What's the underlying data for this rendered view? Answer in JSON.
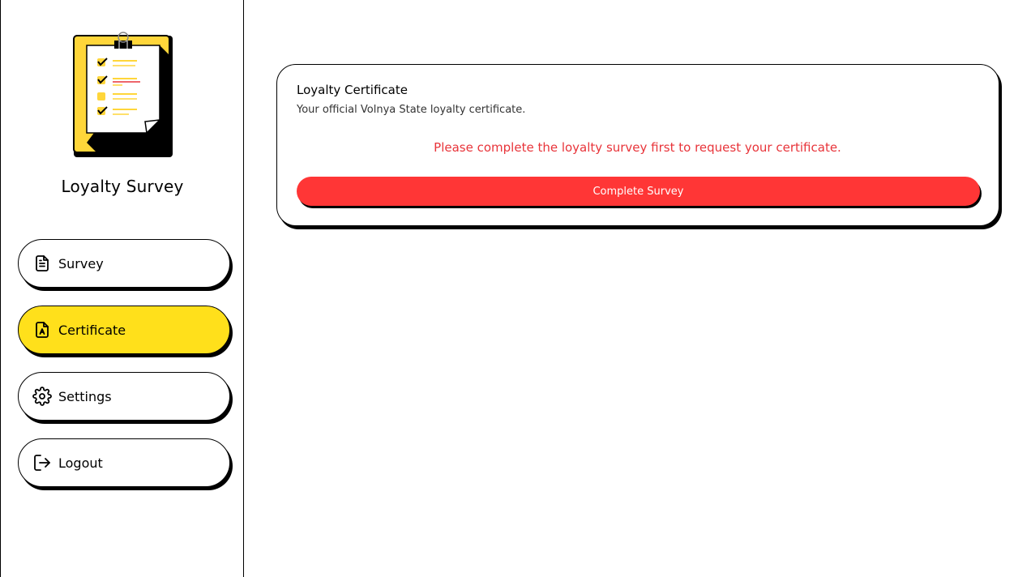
{
  "sidebar": {
    "app_title": "Loyalty Survey",
    "logo_icon": "clipboard-checklist-icon",
    "items": [
      {
        "label": "Survey",
        "icon": "document-icon",
        "active": false
      },
      {
        "label": "Certificate",
        "icon": "certificate-icon",
        "active": true
      },
      {
        "label": "Settings",
        "icon": "gear-icon",
        "active": false
      },
      {
        "label": "Logout",
        "icon": "logout-icon",
        "active": false
      }
    ]
  },
  "main": {
    "card": {
      "title": "Loyalty Certificate",
      "subtitle": "Your official Volnya State loyalty certificate.",
      "message": "Please complete the loyalty survey first to request your certificate.",
      "button_label": "Complete Survey"
    }
  },
  "colors": {
    "accent_yellow": "#FFE01B",
    "alert_red": "#E8343A",
    "button_red": "#FF3636",
    "border": "#000000"
  }
}
